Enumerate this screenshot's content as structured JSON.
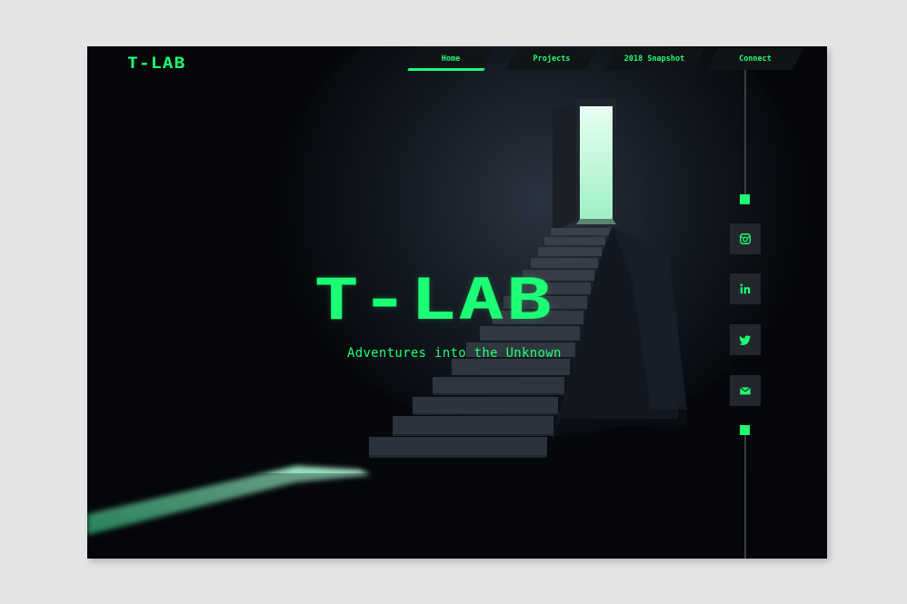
{
  "brand": {
    "logo": "T-LAB"
  },
  "nav": {
    "items": [
      {
        "label": "Home",
        "active": true
      },
      {
        "label": "Projects",
        "active": false
      },
      {
        "label": "2018 Snapshot",
        "active": false
      },
      {
        "label": "Connect",
        "active": false
      }
    ]
  },
  "hero": {
    "title": "T-LAB",
    "subtitle": "Adventures into the Unknown"
  },
  "social": [
    {
      "icon": "instagram-icon"
    },
    {
      "icon": "linkedin-icon"
    },
    {
      "icon": "twitter-icon"
    },
    {
      "icon": "mail-icon"
    }
  ],
  "colors": {
    "accent": "#1dff74",
    "background": "#05070b",
    "tab": "#111417",
    "social_tile": "#23272d"
  }
}
